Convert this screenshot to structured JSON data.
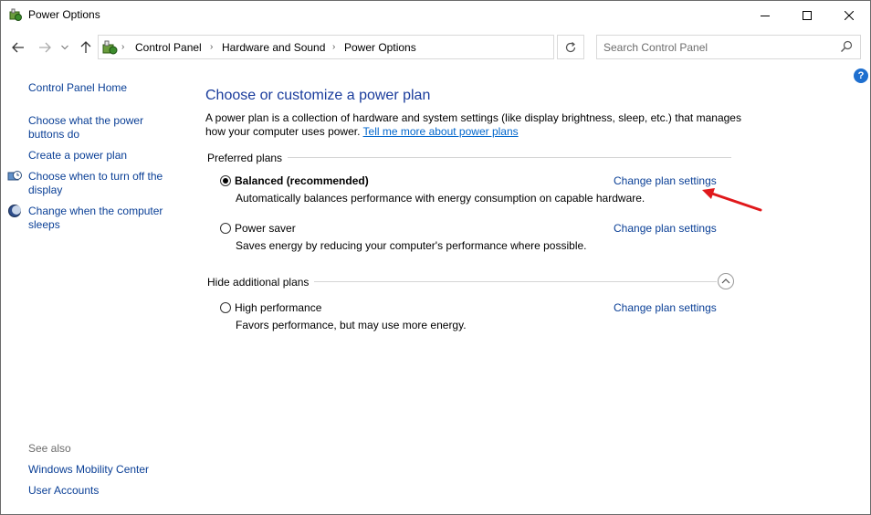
{
  "window": {
    "title": "Power Options"
  },
  "address_bar": {
    "breadcrumbs": [
      "Control Panel",
      "Hardware and Sound",
      "Power Options"
    ]
  },
  "search": {
    "placeholder": "Search Control Panel"
  },
  "help": {
    "label": "?"
  },
  "sidebar": {
    "home": "Control Panel Home",
    "links": [
      "Choose what the power buttons do",
      "Create a power plan",
      "Choose when to turn off the display",
      "Change when the computer sleeps"
    ],
    "see_also_label": "See also",
    "see_also_links": [
      "Windows Mobility Center",
      "User Accounts"
    ]
  },
  "main": {
    "heading": "Choose or customize a power plan",
    "description": "A power plan is a collection of hardware and system settings (like display brightness, sleep, etc.) that manages how your computer uses power.",
    "learn_more": "Tell me more about power plans",
    "preferred_label": "Preferred plans",
    "hidden_label": "Hide additional plans",
    "plans": [
      {
        "name": "Balanced (recommended)",
        "description": "Automatically balances performance with energy consumption on capable hardware.",
        "selected": true,
        "action": "Change plan settings"
      },
      {
        "name": "Power saver",
        "description": "Saves energy by reducing your computer's performance where possible.",
        "selected": false,
        "action": "Change plan settings"
      },
      {
        "name": "High performance",
        "description": "Favors performance, but may use more energy.",
        "selected": false,
        "action": "Change plan settings"
      }
    ]
  },
  "colors": {
    "link": "#0a3f96",
    "heading": "#1a3c9c",
    "annotation_arrow": "#e0181b"
  }
}
